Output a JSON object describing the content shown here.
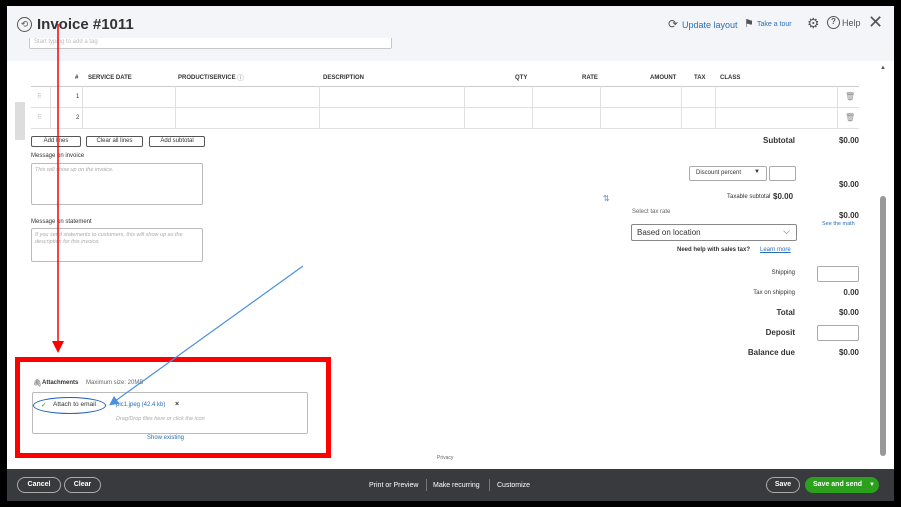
{
  "header": {
    "title": "Invoice #1011",
    "tags_placeholder": "Start typing to add a tag",
    "update_layout": "Update layout",
    "take_tour": "Take a tour",
    "help": "Help"
  },
  "table": {
    "headers": [
      "#",
      "SERVICE DATE",
      "PRODUCT/SERVICE",
      "DESCRIPTION",
      "QTY",
      "RATE",
      "AMOUNT",
      "TAX",
      "CLASS"
    ],
    "rows": [
      "1",
      "2"
    ]
  },
  "buttons": {
    "add_lines": "Add lines",
    "clear_all_lines": "Clear all lines",
    "add_subtotal": "Add subtotal"
  },
  "message_invoice": {
    "label": "Message on invoice",
    "placeholder": "This will show up on the invoice."
  },
  "message_statement": {
    "label": "Message on statement",
    "placeholder": "If you send statements to customers, this will show up as the description for this invoice."
  },
  "summary": {
    "subtotal_label": "Subtotal",
    "subtotal_value": "$0.00",
    "discount_select": "Discount percent",
    "discount_total": "$0.00",
    "taxable_subtotal_label": "Taxable subtotal",
    "taxable_subtotal_value": "$0.00",
    "select_tax_rate": "Select tax rate",
    "tax_rate_value": "Based on location",
    "tax_total": "$0.00",
    "see_math": "See the math",
    "need_help": "Need help with sales tax?",
    "learn_more": "Learn more",
    "shipping": "Shipping",
    "tax_on_shipping": "Tax on shipping",
    "tax_on_shipping_value": "0.00",
    "total": "Total",
    "total_value": "$0.00",
    "deposit": "Deposit",
    "balance_due": "Balance due",
    "balance_due_value": "$0.00"
  },
  "attachments": {
    "label": "Attachments",
    "max_size": "Maximum size: 20MB",
    "attach_to_email": "Attach to email",
    "file": "pic1.jpeg (42.4 kb)",
    "drop_hint": "Drag/Drop files here or click the icon",
    "show_existing": "Show existing"
  },
  "footer": {
    "privacy": "Privacy",
    "cancel": "Cancel",
    "clear": "Clear",
    "print_preview": "Print or Preview",
    "make_recurring": "Make recurring",
    "customize": "Customize",
    "save": "Save",
    "save_and_send": "Save and send"
  },
  "colors": {
    "highlight_red": "#ff0000",
    "annotation_blue": "#1f5fbf",
    "primary_green": "#2ca01c",
    "link_blue": "#2a6fb4",
    "footer_bg": "#393a3d"
  }
}
